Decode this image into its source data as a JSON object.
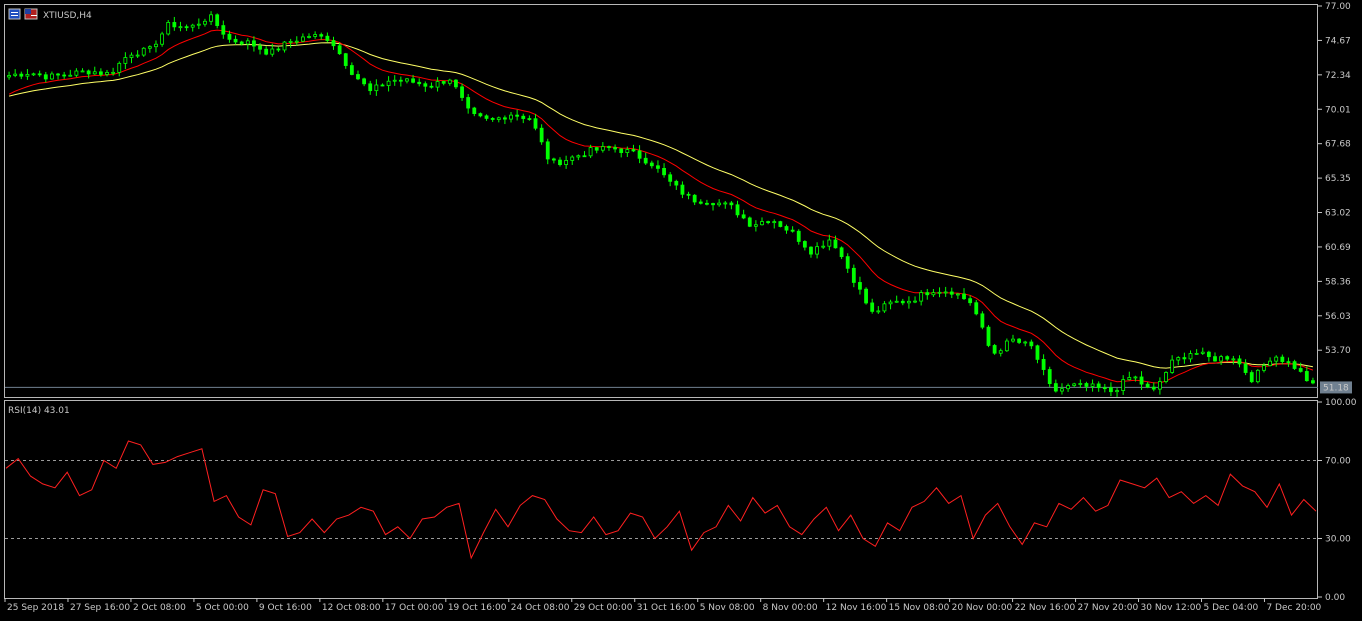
{
  "symbol": "XTIUSD,H4",
  "price_label": "51.18",
  "rsi_label": "RSI(14) 43.01",
  "colors": {
    "background": "#000000",
    "candle": "#00ff00",
    "ma_fast": "#ff0000",
    "ma_slow": "#ffff66",
    "rsi": "#ff2020",
    "price_line": "#708090",
    "axis": "#c8c8c8"
  },
  "chart_data": [
    {
      "type": "candlestick",
      "name": "price",
      "y_ticks": [
        "77.00",
        "74.67",
        "72.34",
        "70.01",
        "67.68",
        "65.35",
        "63.02",
        "60.69",
        "58.36",
        "56.03",
        "53.70"
      ],
      "ylim": [
        50.6,
        77.0
      ],
      "current_price": 51.18,
      "x_ticks": [
        "25 Sep 2018",
        "27 Sep 16:00",
        "2 Oct 08:00",
        "5 Oct 00:00",
        "9 Oct 16:00",
        "12 Oct 08:00",
        "17 Oct 00:00",
        "19 Oct 16:00",
        "24 Oct 08:00",
        "29 Oct 00:00",
        "31 Oct 16:00",
        "5 Nov 08:00",
        "8 Nov 00:00",
        "12 Nov 16:00",
        "15 Nov 08:00",
        "20 Nov 00:00",
        "22 Nov 16:00",
        "27 Nov 20:00",
        "30 Nov 12:00",
        "5 Dec 04:00",
        "7 Dec 20:00"
      ],
      "close_trend": [
        72.3,
        72.5,
        72.2,
        72.4,
        72.6,
        72.4,
        73.8,
        74.0,
        75.8,
        75.5,
        76.3,
        74.7,
        74.5,
        73.8,
        74.6,
        75.0,
        74.8,
        72.7,
        71.2,
        72.0,
        71.9,
        71.6,
        72.1,
        69.6,
        69.2,
        69.7,
        69.4,
        66.3,
        66.7,
        67.2,
        67.4,
        67.1,
        66.4,
        65.0,
        63.9,
        63.8,
        63.4,
        62.2,
        62.6,
        61.7,
        60.4,
        61.3,
        58.8,
        56.2,
        56.9,
        57.1,
        57.8,
        57.7,
        56.9,
        53.4,
        54.4,
        53.9,
        50.9,
        51.3,
        51.2,
        50.9,
        52.0,
        50.8,
        52.9,
        53.6,
        53.1,
        53.3,
        51.7,
        53.4,
        52.7,
        51.3
      ]
    },
    {
      "type": "line",
      "name": "RSI",
      "y_ticks": [
        "100.00",
        "70.00",
        "30.00",
        "0.00"
      ],
      "ylim": [
        0,
        100
      ],
      "levels": [
        70,
        30
      ],
      "last_value": 43.01,
      "values": [
        66,
        71,
        62,
        58,
        56,
        64,
        52,
        55,
        70,
        66,
        80,
        78,
        68,
        69,
        72,
        74,
        76,
        49,
        52,
        41,
        37,
        55,
        53,
        31,
        33,
        40,
        33,
        40,
        42,
        46,
        44,
        32,
        36,
        30,
        40,
        41,
        46,
        48,
        20,
        33,
        45,
        36,
        47,
        52,
        50,
        40,
        34,
        33,
        41,
        32,
        34,
        43,
        41,
        30,
        36,
        44,
        24,
        33,
        36,
        47,
        39,
        51,
        43,
        47,
        36,
        32,
        40,
        46,
        34,
        42,
        30,
        26,
        38,
        34,
        46,
        49,
        56,
        48,
        52,
        30,
        42,
        48,
        36,
        27,
        38,
        36,
        48,
        45,
        51,
        44,
        47,
        60,
        58,
        56,
        61,
        51,
        54,
        48,
        52,
        47,
        63,
        57,
        54,
        46,
        58,
        42,
        50,
        44
      ]
    }
  ]
}
